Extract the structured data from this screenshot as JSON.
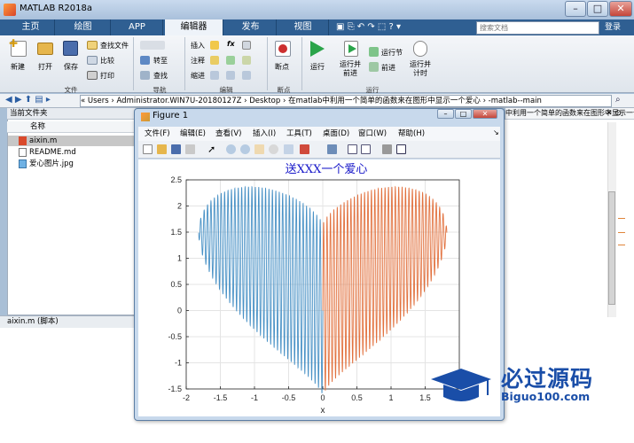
{
  "app": {
    "title": "MATLAB R2018a",
    "min": "–",
    "max": "□",
    "close": "✕"
  },
  "tabs": [
    {
      "label": "主页"
    },
    {
      "label": "绘图"
    },
    {
      "label": "APP"
    },
    {
      "label": "编辑器"
    },
    {
      "label": "发布"
    },
    {
      "label": "视图"
    }
  ],
  "search": {
    "placeholder": "搜索文档"
  },
  "login": "登录",
  "ribbon": {
    "file": {
      "new": "新建",
      "open": "打开",
      "save": "保存",
      "find_files": "查找文件",
      "compare": "比较",
      "print": "打印",
      "section": "文件"
    },
    "nav": {
      "goto": "转至",
      "find": "查找",
      "section": "导航"
    },
    "edit": {
      "insert": "插入",
      "comment": "注释",
      "indent": "缩进",
      "fx": "fx",
      "section": "编辑"
    },
    "breakpoints": {
      "label": "断点",
      "section": "断点"
    },
    "run": {
      "run": "运行",
      "run_advance": "运行并\n前进",
      "run_section": "运行节",
      "advance": "前进",
      "run_time": "运行并\n计时",
      "section": "运行"
    }
  },
  "address": {
    "path": "« Users › Administrator.WIN7U-20180127Z › Desktop › 在matlab中利用一个简单的函数来在图形中显示一个爱心 › -matlab--main"
  },
  "file_panel": {
    "title": "当前文件夹",
    "col_name": "名称",
    "files": [
      {
        "name": "aixin.m",
        "selected": true
      },
      {
        "name": "README.md",
        "selected": false
      },
      {
        "name": "爱心图片.jpg",
        "selected": false
      }
    ]
  },
  "script_bar": "aixin.m  (脚本)",
  "editor_tab": "中利用一个简单的函数来在图形中显示一个爱心\\",
  "figure": {
    "title": "Figure 1",
    "menus": [
      "文件(F)",
      "编辑(E)",
      "查看(V)",
      "插入(I)",
      "工具(T)",
      "桌面(D)",
      "窗口(W)",
      "帮助(H)"
    ]
  },
  "chart_data": {
    "type": "line",
    "title": "送XXX一个爱心",
    "xlabel": "x",
    "ylabel": "",
    "xlim": [
      -2,
      2
    ],
    "ylim": [
      -1.5,
      2.5
    ],
    "xticks": [
      -2,
      -1.5,
      -1,
      -0.5,
      0,
      0.5,
      1,
      1.5,
      2
    ],
    "yticks": [
      -1.5,
      -1,
      -0.5,
      0,
      0.5,
      1,
      1.5,
      2,
      2.5
    ],
    "grid": true,
    "series": [
      {
        "side": "left",
        "color": "#4a92c6",
        "x_range": [
          -1.817,
          0
        ],
        "function": "y = x^(2/3) + 0.9*sqrt(3.3 - x^2)*sin(a*pi*x)"
      },
      {
        "side": "right",
        "color": "#e2723f",
        "x_range": [
          0,
          1.817
        ],
        "function": "y = x^(2/3) + 0.9*sqrt(3.3 - x^2)*sin(a*pi*x)"
      }
    ]
  },
  "watermark": {
    "text": "必过源码",
    "url": "Biguo100.com"
  }
}
